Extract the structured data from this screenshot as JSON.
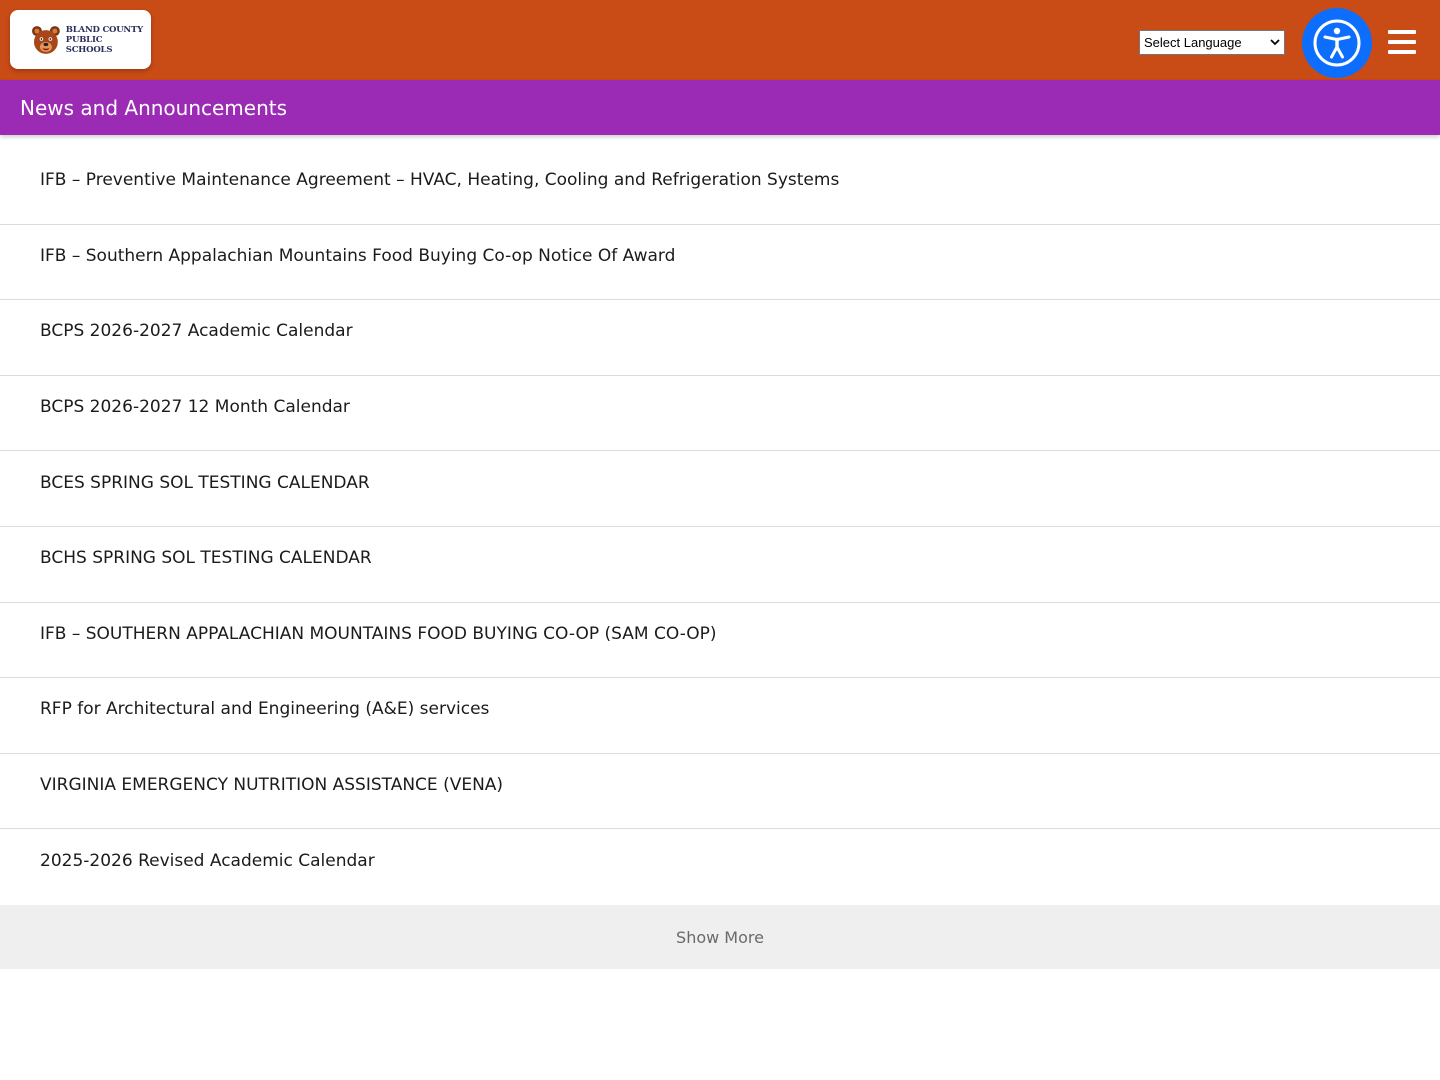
{
  "header": {
    "logo_line1": "BLAND COUNTY",
    "logo_line2": "PUBLIC SCHOOLS",
    "language_select": "Select Language",
    "accessibility_icon": "accessibility-person-icon",
    "menu_icon": "hamburger-menu-icon"
  },
  "section": {
    "title": "News and Announcements"
  },
  "news": [
    "IFB – Preventive Maintenance Agreement – HVAC, Heating, Cooling and Refrigeration Systems",
    "IFB – Southern Appalachian Mountains Food Buying Co-op Notice Of Award",
    "BCPS 2026-2027 Academic Calendar",
    "BCPS 2026-2027 12 Month Calendar",
    "BCES SPRING SOL TESTING CALENDAR",
    "BCHS SPRING SOL TESTING CALENDAR",
    "IFB – SOUTHERN APPALACHIAN MOUNTAINS FOOD BUYING CO-OP (SAM CO-OP)",
    "RFP for Architectural and Engineering (A&E) services",
    "VIRGINIA EMERGENCY NUTRITION ASSISTANCE (VENA)",
    "2025-2026 Revised Academic Calendar"
  ],
  "show_more": "Show More",
  "colors": {
    "header_bg": "#c94b16",
    "section_bg": "#9b2ab5",
    "accessibility_bg": "#0d6efd"
  }
}
